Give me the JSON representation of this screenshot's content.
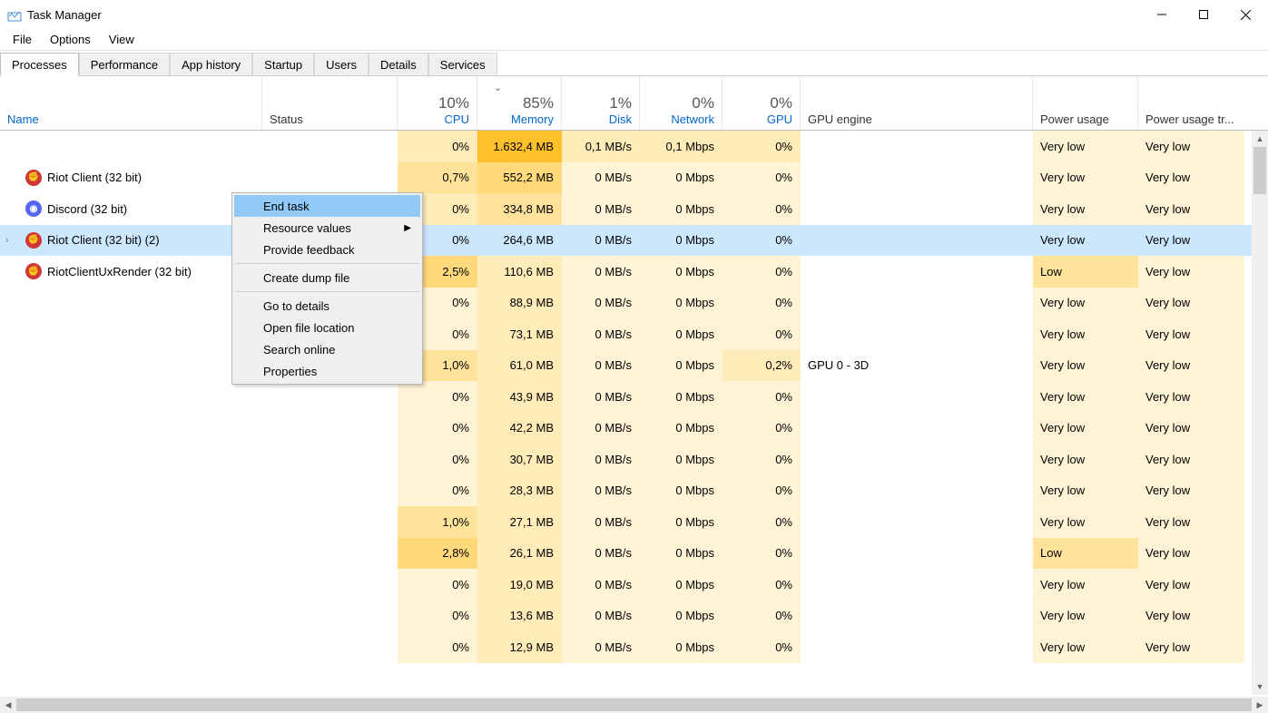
{
  "titlebar": {
    "title": "Task Manager"
  },
  "menubar": {
    "items": [
      "File",
      "Options",
      "View"
    ]
  },
  "tabs": {
    "items": [
      "Processes",
      "Performance",
      "App history",
      "Startup",
      "Users",
      "Details",
      "Services"
    ],
    "active": 0
  },
  "columns": {
    "name": "Name",
    "status": "Status",
    "cpu": {
      "pct": "10%",
      "label": "CPU"
    },
    "memory": {
      "pct": "85%",
      "label": "Memory"
    },
    "disk": {
      "pct": "1%",
      "label": "Disk"
    },
    "network": {
      "pct": "0%",
      "label": "Network"
    },
    "gpu": {
      "pct": "0%",
      "label": "GPU"
    },
    "gpu_engine": "GPU engine",
    "power": "Power usage",
    "power_trend": "Power usage tr..."
  },
  "processes": [
    {
      "name": "",
      "icon": "",
      "expandable": false
    },
    {
      "name": "Riot Client (32 bit)",
      "icon": "riot",
      "expandable": false,
      "selected": true
    },
    {
      "name": "Discord (32 bit)",
      "icon": "discord",
      "expandable": false
    },
    {
      "name": "Riot Client (32 bit) (2)",
      "icon": "riot",
      "expandable": true
    },
    {
      "name": "RiotClientUxRender (32 bit)",
      "icon": "riot",
      "expandable": false
    }
  ],
  "rows": [
    {
      "cpu": "0%",
      "cpu_heat": 1,
      "mem": "1.632,4 MB",
      "mem_heat": 5,
      "disk": "0,1 MB/s",
      "disk_heat": 1,
      "net": "0,1 Mbps",
      "net_heat": 1,
      "gpu": "0%",
      "gpu_heat": 1,
      "gpueng": "",
      "power": "Very low",
      "power_heat": 0,
      "powertr": "Very low"
    },
    {
      "cpu": "0,7%",
      "cpu_heat": 2,
      "mem": "552,2 MB",
      "mem_heat": 3,
      "disk": "0 MB/s",
      "disk_heat": 0,
      "net": "0 Mbps",
      "net_heat": 0,
      "gpu": "0%",
      "gpu_heat": 0,
      "gpueng": "",
      "power": "Very low",
      "power_heat": 0,
      "powertr": "Very low"
    },
    {
      "cpu": "0%",
      "cpu_heat": 1,
      "mem": "334,8 MB",
      "mem_heat": 2,
      "disk": "0 MB/s",
      "disk_heat": 0,
      "net": "0 Mbps",
      "net_heat": 0,
      "gpu": "0%",
      "gpu_heat": 0,
      "gpueng": "",
      "power": "Very low",
      "power_heat": 0,
      "powertr": "Very low"
    },
    {
      "selected": true,
      "cpu": "0%",
      "cpu_heat": 0,
      "mem": "264,6 MB",
      "mem_heat": 0,
      "disk": "0 MB/s",
      "disk_heat": 0,
      "net": "0 Mbps",
      "net_heat": 0,
      "gpu": "0%",
      "gpu_heat": 0,
      "gpueng": "",
      "power": "Very low",
      "power_heat": 0,
      "powertr": "Very low"
    },
    {
      "cpu": "2,5%",
      "cpu_heat": 3,
      "mem": "110,6 MB",
      "mem_heat": 1,
      "disk": "0 MB/s",
      "disk_heat": 0,
      "net": "0 Mbps",
      "net_heat": 0,
      "gpu": "0%",
      "gpu_heat": 0,
      "gpueng": "",
      "power": "Low",
      "power_heat": 2,
      "powertr": "Very low"
    },
    {
      "cpu": "0%",
      "cpu_heat": 0,
      "mem": "88,9 MB",
      "mem_heat": 1,
      "disk": "0 MB/s",
      "disk_heat": 0,
      "net": "0 Mbps",
      "net_heat": 0,
      "gpu": "0%",
      "gpu_heat": 0,
      "gpueng": "",
      "power": "Very low",
      "power_heat": 0,
      "powertr": "Very low"
    },
    {
      "cpu": "0%",
      "cpu_heat": 0,
      "mem": "73,1 MB",
      "mem_heat": 1,
      "disk": "0 MB/s",
      "disk_heat": 0,
      "net": "0 Mbps",
      "net_heat": 0,
      "gpu": "0%",
      "gpu_heat": 0,
      "gpueng": "",
      "power": "Very low",
      "power_heat": 0,
      "powertr": "Very low"
    },
    {
      "cpu": "1,0%",
      "cpu_heat": 2,
      "mem": "61,0 MB",
      "mem_heat": 1,
      "disk": "0 MB/s",
      "disk_heat": 0,
      "net": "0 Mbps",
      "net_heat": 0,
      "gpu": "0,2%",
      "gpu_heat": 1,
      "gpueng": "GPU 0 - 3D",
      "power": "Very low",
      "power_heat": 0,
      "powertr": "Very low"
    },
    {
      "cpu": "0%",
      "cpu_heat": 0,
      "mem": "43,9 MB",
      "mem_heat": 1,
      "disk": "0 MB/s",
      "disk_heat": 0,
      "net": "0 Mbps",
      "net_heat": 0,
      "gpu": "0%",
      "gpu_heat": 0,
      "gpueng": "",
      "power": "Very low",
      "power_heat": 0,
      "powertr": "Very low"
    },
    {
      "cpu": "0%",
      "cpu_heat": 0,
      "mem": "42,2 MB",
      "mem_heat": 1,
      "disk": "0 MB/s",
      "disk_heat": 0,
      "net": "0 Mbps",
      "net_heat": 0,
      "gpu": "0%",
      "gpu_heat": 0,
      "gpueng": "",
      "power": "Very low",
      "power_heat": 0,
      "powertr": "Very low"
    },
    {
      "cpu": "0%",
      "cpu_heat": 0,
      "mem": "30,7 MB",
      "mem_heat": 1,
      "disk": "0 MB/s",
      "disk_heat": 0,
      "net": "0 Mbps",
      "net_heat": 0,
      "gpu": "0%",
      "gpu_heat": 0,
      "gpueng": "",
      "power": "Very low",
      "power_heat": 0,
      "powertr": "Very low"
    },
    {
      "cpu": "0%",
      "cpu_heat": 0,
      "mem": "28,3 MB",
      "mem_heat": 1,
      "disk": "0 MB/s",
      "disk_heat": 0,
      "net": "0 Mbps",
      "net_heat": 0,
      "gpu": "0%",
      "gpu_heat": 0,
      "gpueng": "",
      "power": "Very low",
      "power_heat": 0,
      "powertr": "Very low"
    },
    {
      "cpu": "1,0%",
      "cpu_heat": 2,
      "mem": "27,1 MB",
      "mem_heat": 1,
      "disk": "0 MB/s",
      "disk_heat": 0,
      "net": "0 Mbps",
      "net_heat": 0,
      "gpu": "0%",
      "gpu_heat": 0,
      "gpueng": "",
      "power": "Very low",
      "power_heat": 0,
      "powertr": "Very low"
    },
    {
      "cpu": "2,8%",
      "cpu_heat": 3,
      "mem": "26,1 MB",
      "mem_heat": 1,
      "disk": "0 MB/s",
      "disk_heat": 0,
      "net": "0 Mbps",
      "net_heat": 0,
      "gpu": "0%",
      "gpu_heat": 0,
      "gpueng": "",
      "power": "Low",
      "power_heat": 2,
      "powertr": "Very low"
    },
    {
      "cpu": "0%",
      "cpu_heat": 0,
      "mem": "19,0 MB",
      "mem_heat": 1,
      "disk": "0 MB/s",
      "disk_heat": 0,
      "net": "0 Mbps",
      "net_heat": 0,
      "gpu": "0%",
      "gpu_heat": 0,
      "gpueng": "",
      "power": "Very low",
      "power_heat": 0,
      "powertr": "Very low"
    },
    {
      "cpu": "0%",
      "cpu_heat": 0,
      "mem": "13,6 MB",
      "mem_heat": 1,
      "disk": "0 MB/s",
      "disk_heat": 0,
      "net": "0 Mbps",
      "net_heat": 0,
      "gpu": "0%",
      "gpu_heat": 0,
      "gpueng": "",
      "power": "Very low",
      "power_heat": 0,
      "powertr": "Very low"
    },
    {
      "cpu": "0%",
      "cpu_heat": 0,
      "mem": "12,9 MB",
      "mem_heat": 1,
      "disk": "0 MB/s",
      "disk_heat": 0,
      "net": "0 Mbps",
      "net_heat": 0,
      "gpu": "0%",
      "gpu_heat": 0,
      "gpueng": "",
      "power": "Very low",
      "power_heat": 0,
      "powertr": "Very low"
    }
  ],
  "context_menu": {
    "items": [
      {
        "label": "End task",
        "highlight": true
      },
      {
        "label": "Resource values",
        "submenu": true
      },
      {
        "label": "Provide feedback"
      },
      {
        "sep": true
      },
      {
        "label": "Create dump file"
      },
      {
        "sep": true
      },
      {
        "label": "Go to details"
      },
      {
        "label": "Open file location"
      },
      {
        "label": "Search online"
      },
      {
        "label": "Properties"
      }
    ]
  }
}
